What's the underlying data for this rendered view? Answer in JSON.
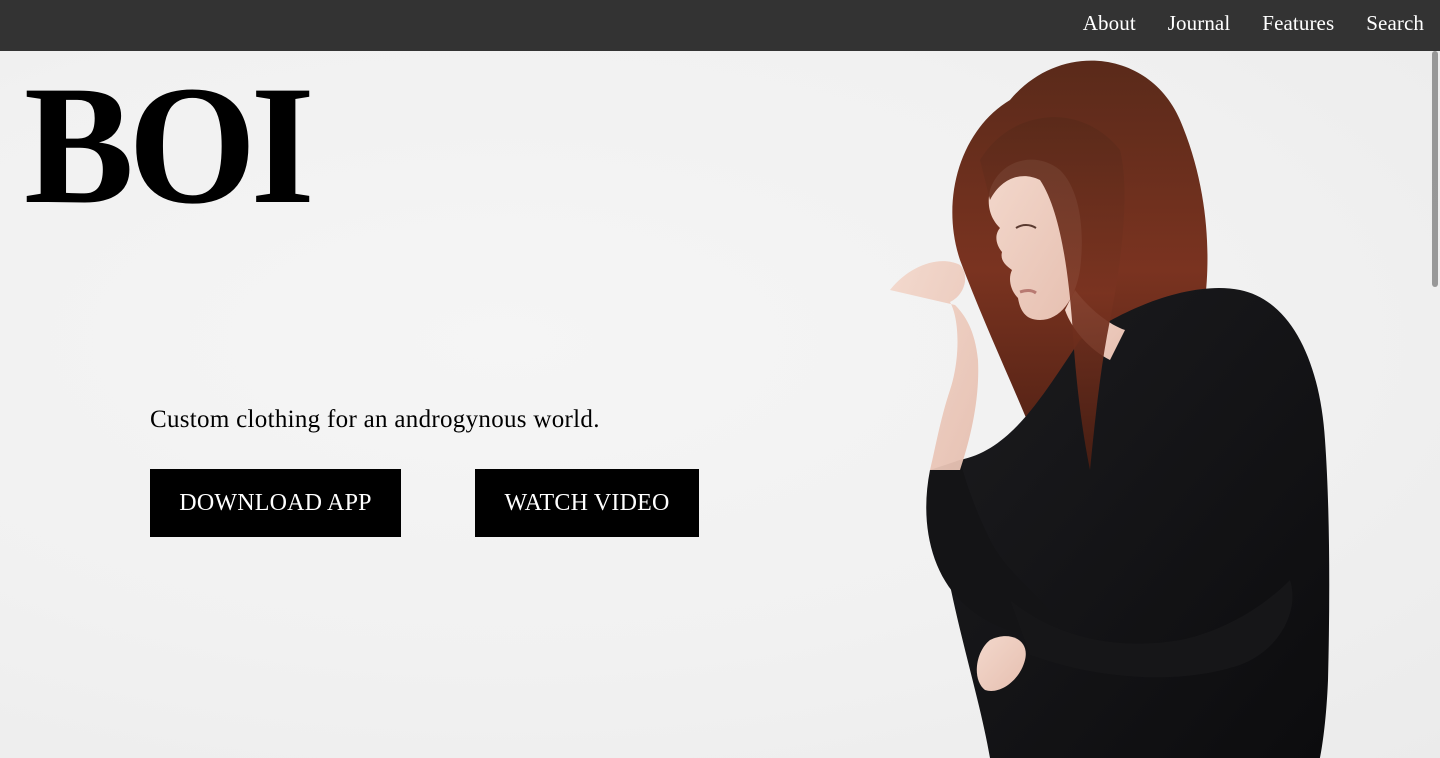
{
  "nav": {
    "items": [
      {
        "label": "About"
      },
      {
        "label": "Journal"
      },
      {
        "label": "Features"
      },
      {
        "label": "Search"
      }
    ]
  },
  "hero": {
    "logo": "BOI",
    "tagline": "Custom clothing for an androgynous world.",
    "download_label": "DOWNLOAD APP",
    "video_label": "WATCH VIDEO"
  },
  "colors": {
    "topbar": "#333333",
    "button": "#000000",
    "background": "#f0f0f0"
  }
}
